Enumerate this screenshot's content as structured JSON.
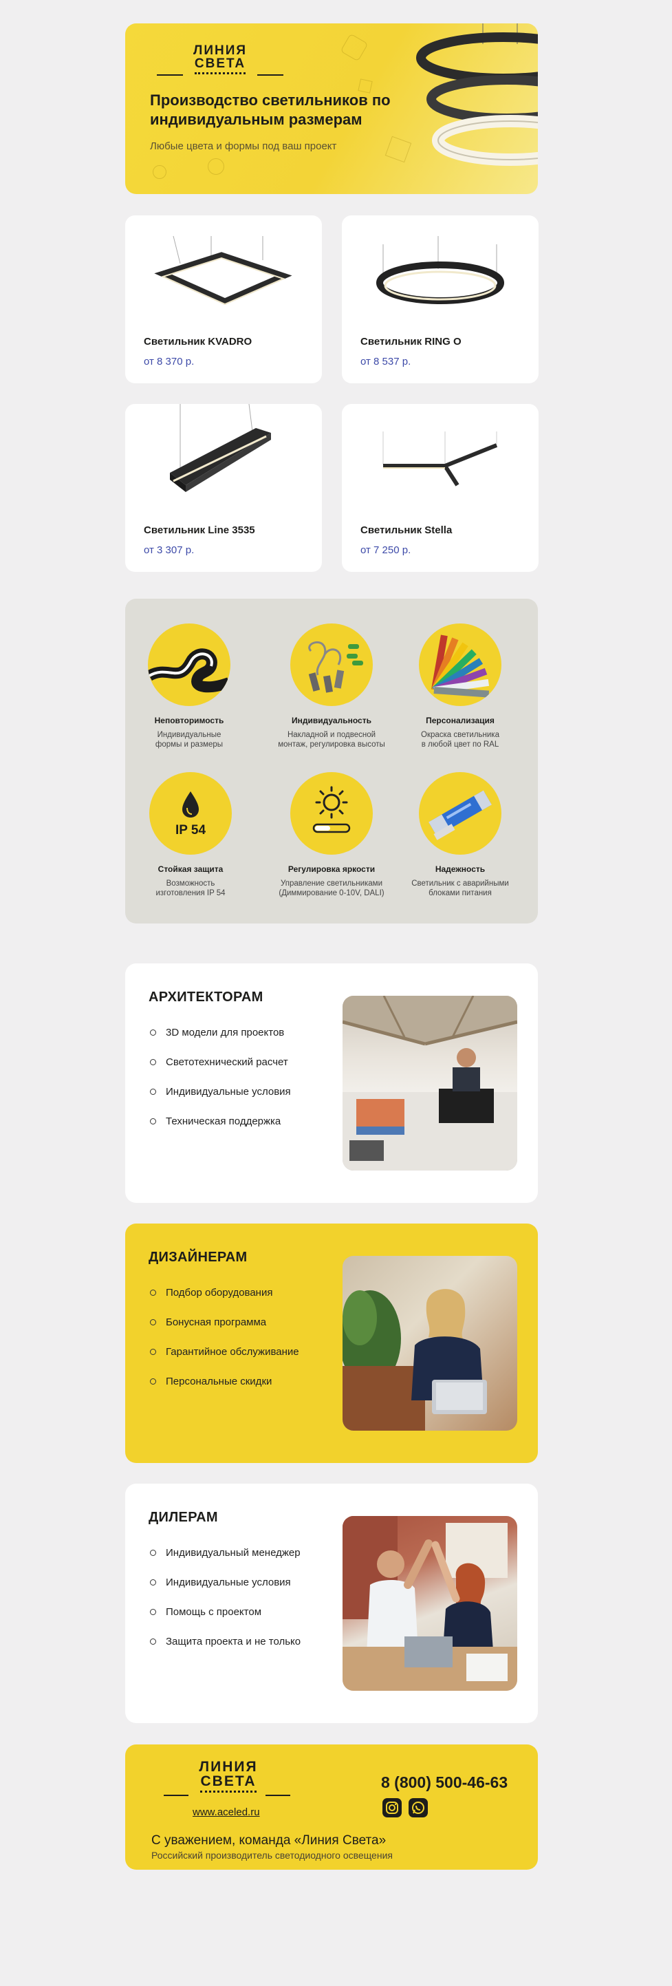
{
  "hero": {
    "logo_line1": "ЛИНИЯ",
    "logo_line2": "СВЕТА",
    "title": "Производство светильников по индивидуальным размерам",
    "subtitle": "Любые цвета и формы под ваш проект"
  },
  "products": [
    {
      "name": "Светильник KVADRO",
      "price": "от 8 370 р.",
      "icon": "square-pendant-lamp"
    },
    {
      "name": "Светильник RING O",
      "price": "от 8 537 р.",
      "icon": "ring-pendant-lamp"
    },
    {
      "name": "Светильник Line 3535",
      "price": "от 3 307 р.",
      "icon": "linear-pendant-lamp"
    },
    {
      "name": "Светильник Stella",
      "price": "от 7 250 р.",
      "icon": "star-pendant-lamp"
    }
  ],
  "features": [
    {
      "title": "Неповторимость",
      "desc_1": "Индивидуальные",
      "desc_2": "формы и размеры"
    },
    {
      "title": "Индивидуальность",
      "desc_1": "Накладной и подвесной",
      "desc_2": "монтаж, регулировка высоты"
    },
    {
      "title": "Персонализация",
      "desc_1": "Окраска светильника",
      "desc_2": "в любой цвет по RAL"
    },
    {
      "title": "Стойкая защита",
      "desc_1": "Возможность",
      "desc_2": "изготовления IP 54",
      "badge": "IP 54"
    },
    {
      "title": "Регулировка яркости",
      "desc_1": "Управление светильниками",
      "desc_2": "(Диммирование 0-10V, DALI)"
    },
    {
      "title": "Надежность",
      "desc_1": "Светильник с аварийными",
      "desc_2": "блоками питания"
    }
  ],
  "architects": {
    "title": "АРХИТЕКТОРАМ",
    "items": [
      "3D модели для проектов",
      "Светотехнический расчет",
      "Индивидуальные условия",
      "Техническая поддержка"
    ]
  },
  "designers": {
    "title": "ДИЗАЙНЕРАМ",
    "items": [
      "Подбор оборудования",
      "Бонусная программа",
      "Гарантийное обслуживание",
      "Персональные скидки"
    ]
  },
  "dealers": {
    "title": "ДИЛЕРАМ",
    "items": [
      "Индивидуальный менеджер",
      "Индивидуальные условия",
      "Помощь с проектом",
      "Защита проекта и не только"
    ]
  },
  "footer": {
    "logo_line1": "ЛИНИЯ",
    "logo_line2": "СВЕТА",
    "site": "www.aceled.ru",
    "phone": "8 (800) 500-46-63",
    "regards": "С уважением, команда «Линия Света»",
    "tagline": "Российский производитель светодиодного освещения"
  },
  "colors": {
    "brand_yellow": "#f2d22c",
    "price_blue": "#3d4aa8",
    "background": "#f0eff0",
    "features_bg": "#deddd7"
  }
}
